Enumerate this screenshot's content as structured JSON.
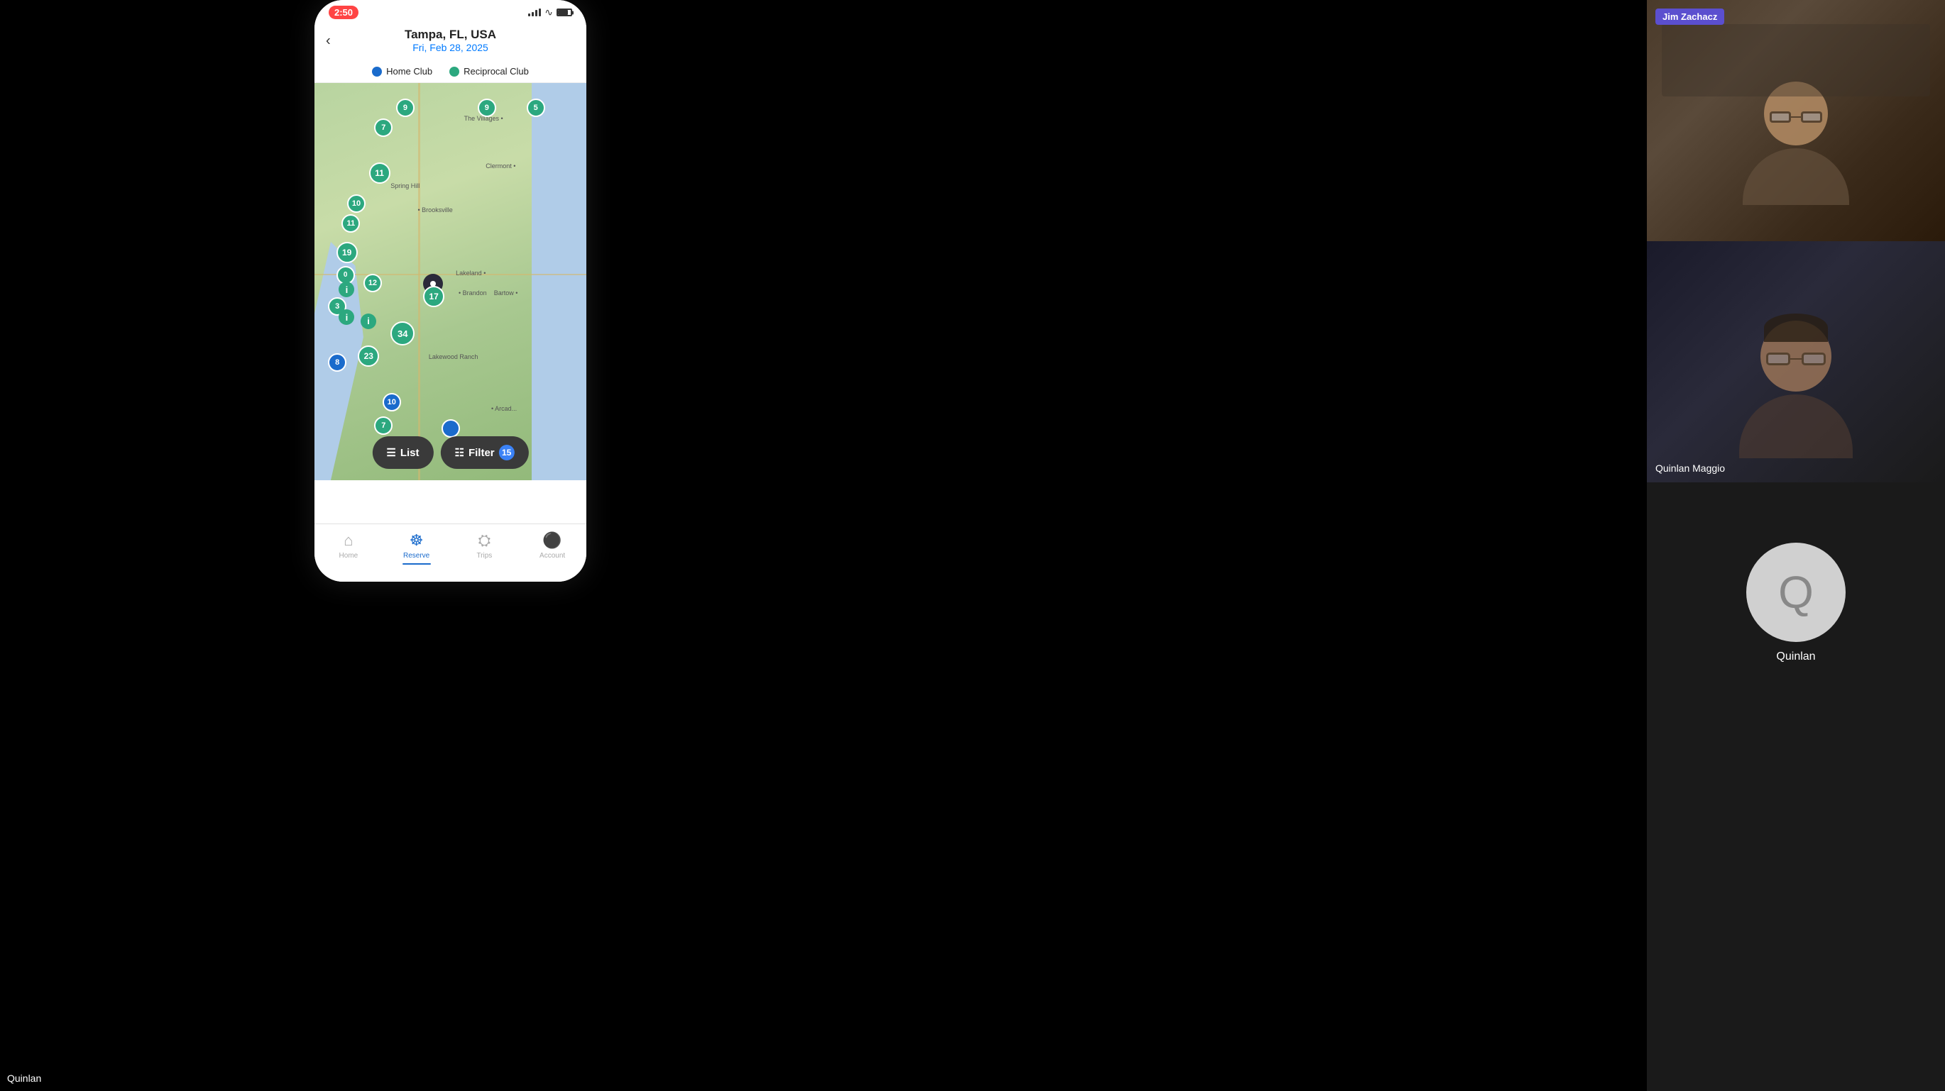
{
  "app": {
    "status_time": "2:50",
    "location": "Tampa, FL, USA",
    "date": "Fri, Feb 28, 2025"
  },
  "legend": {
    "home_club_label": "Home Club",
    "reciprocal_club_label": "Reciprocal Club"
  },
  "map": {
    "labels": [
      "The Villages",
      "Brooksville",
      "Clermont",
      "Spring Hill",
      "Lakeland",
      "Brandon",
      "Bartow",
      "Lakewood Ranch",
      "Arcad..."
    ],
    "clusters": [
      {
        "id": "c1",
        "value": "9",
        "type": "reciprocal",
        "top": "6%",
        "left": "32%",
        "size": "sm"
      },
      {
        "id": "c2",
        "value": "7",
        "type": "reciprocal",
        "top": "10%",
        "left": "26%",
        "size": "sm"
      },
      {
        "id": "c3",
        "value": "9",
        "type": "reciprocal",
        "top": "6%",
        "left": "62%",
        "size": "sm"
      },
      {
        "id": "c4",
        "value": "5",
        "type": "reciprocal",
        "top": "6%",
        "left": "80%",
        "size": "sm"
      },
      {
        "id": "c5",
        "value": "11",
        "type": "reciprocal",
        "top": "21%",
        "left": "22%",
        "size": "md"
      },
      {
        "id": "c6",
        "value": "10",
        "type": "reciprocal",
        "top": "29%",
        "left": "17%",
        "size": "sm"
      },
      {
        "id": "c7",
        "value": "11",
        "type": "reciprocal",
        "top": "34%",
        "left": "14%",
        "size": "sm"
      },
      {
        "id": "c8",
        "value": "19",
        "type": "reciprocal",
        "top": "41%",
        "left": "11%",
        "size": "md"
      },
      {
        "id": "c9",
        "value": "0",
        "type": "reciprocal",
        "top": "48%",
        "left": "10%",
        "size": "sm"
      },
      {
        "id": "c10",
        "value": "12",
        "type": "reciprocal",
        "top": "50%",
        "left": "20%",
        "size": "sm"
      },
      {
        "id": "c11",
        "value": "3",
        "type": "reciprocal",
        "top": "55%",
        "left": "8%",
        "size": "sm"
      },
      {
        "id": "c12",
        "value": "17",
        "type": "reciprocal",
        "top": "52%",
        "left": "42%",
        "size": "md"
      },
      {
        "id": "c13",
        "value": "34",
        "type": "reciprocal",
        "top": "62%",
        "left": "30%",
        "size": "lg"
      },
      {
        "id": "c14",
        "value": "8",
        "type": "home",
        "top": "70%",
        "left": "8%",
        "size": "sm"
      },
      {
        "id": "c15",
        "value": "23",
        "type": "reciprocal",
        "top": "67%",
        "left": "19%",
        "size": "md"
      },
      {
        "id": "c16",
        "value": "10",
        "type": "home",
        "top": "79%",
        "left": "28%",
        "size": "sm"
      },
      {
        "id": "c17",
        "value": "7",
        "type": "reciprocal",
        "top": "84%",
        "left": "26%",
        "size": "sm"
      }
    ],
    "info_markers": [
      {
        "top": "53%",
        "left": "12%"
      },
      {
        "top": "59%",
        "left": "11%"
      },
      {
        "top": "60%",
        "left": "18%"
      }
    ]
  },
  "buttons": {
    "list_label": "List",
    "filter_label": "Filter",
    "filter_count": "15"
  },
  "tabs": [
    {
      "id": "home",
      "label": "Home",
      "active": false
    },
    {
      "id": "reserve",
      "label": "Reserve",
      "active": true
    },
    {
      "id": "trips",
      "label": "Trips",
      "active": false
    },
    {
      "id": "account",
      "label": "Account",
      "active": false
    }
  ],
  "participants": [
    {
      "name": "Jim Zachacz",
      "badge": "Jim Zachacz",
      "has_badge": true,
      "type": "video"
    },
    {
      "name": "Quinlan Maggio",
      "has_badge": false,
      "type": "video"
    },
    {
      "name": "Quinlan",
      "has_badge": false,
      "type": "avatar"
    }
  ],
  "bottom_label": "Quinlan"
}
